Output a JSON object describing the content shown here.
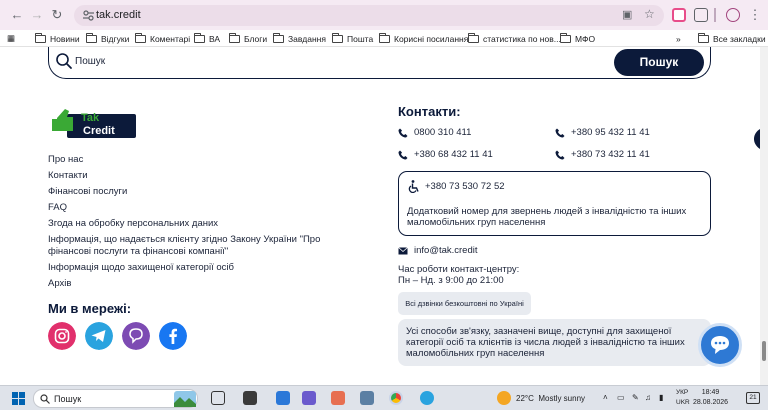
{
  "browser": {
    "url": "tak.credit",
    "bookmarks": [
      "Новини",
      "Відгуки",
      "Коментарі",
      "ВА",
      "Блоги",
      "Завдання",
      "Пошта",
      "Корисні посилання",
      "статистика по нов...",
      "МФО"
    ],
    "all_bookmarks": "Все закладки",
    "more_bookmarks": "»"
  },
  "search": {
    "placeholder": "Пошук",
    "button": "Пошук"
  },
  "logo": {
    "line1": "Tak",
    "line2": "Credit"
  },
  "links": [
    "Про нас",
    "Контакти",
    "Фінансові послуги",
    "FAQ",
    "Згода на обробку персональних даних",
    "Інформація, що надається клієнту згідно Закону України \"Про фінансові послуги та фінансові компанії\"",
    "Інформація щодо захищеної категорії осіб",
    "Архів"
  ],
  "social": {
    "title": "Ми в мережі:",
    "networks": [
      "instagram",
      "telegram",
      "viber",
      "facebook"
    ]
  },
  "contacts": {
    "title": "Контакти:",
    "phones": [
      "0800 310 411",
      "+380 95 432 11 41",
      "+380 68 432 11 41",
      "+380 73 432 11 41"
    ],
    "accessible": {
      "phone": "+380 73 530 72 52",
      "text": "Додатковий номер для звернень людей з інвалідністю та інших маломобільних груп населення"
    },
    "email": "info@tak.credit",
    "hours_title": "Час роботи контакт-центру:",
    "hours": "Пн – Нд. з 9:00 до 21:00",
    "free_calls": "Всі дзвінки безкоштовні по Україні",
    "note": "Усі способи зв'язку, зазначені вище, доступні для захищеної категорії осіб та клієнтів із числа людей з інвалідністю та інших маломобільних груп населення"
  },
  "taskbar": {
    "search": "Пошук",
    "weather_temp": "22°C",
    "weather_text": "Mostly sunny",
    "lang1": "УКР",
    "lang2": "UKR",
    "time": "18:49",
    "date": "28.08.2026",
    "notif": "21"
  },
  "colors": {
    "navy": "#0c1a3a",
    "logo_green": "#3aa935",
    "instagram": "#e1306c",
    "telegram": "#2aa3df",
    "viber": "#7d4bb3",
    "facebook": "#1877f2",
    "chat": "#2e79d4"
  }
}
